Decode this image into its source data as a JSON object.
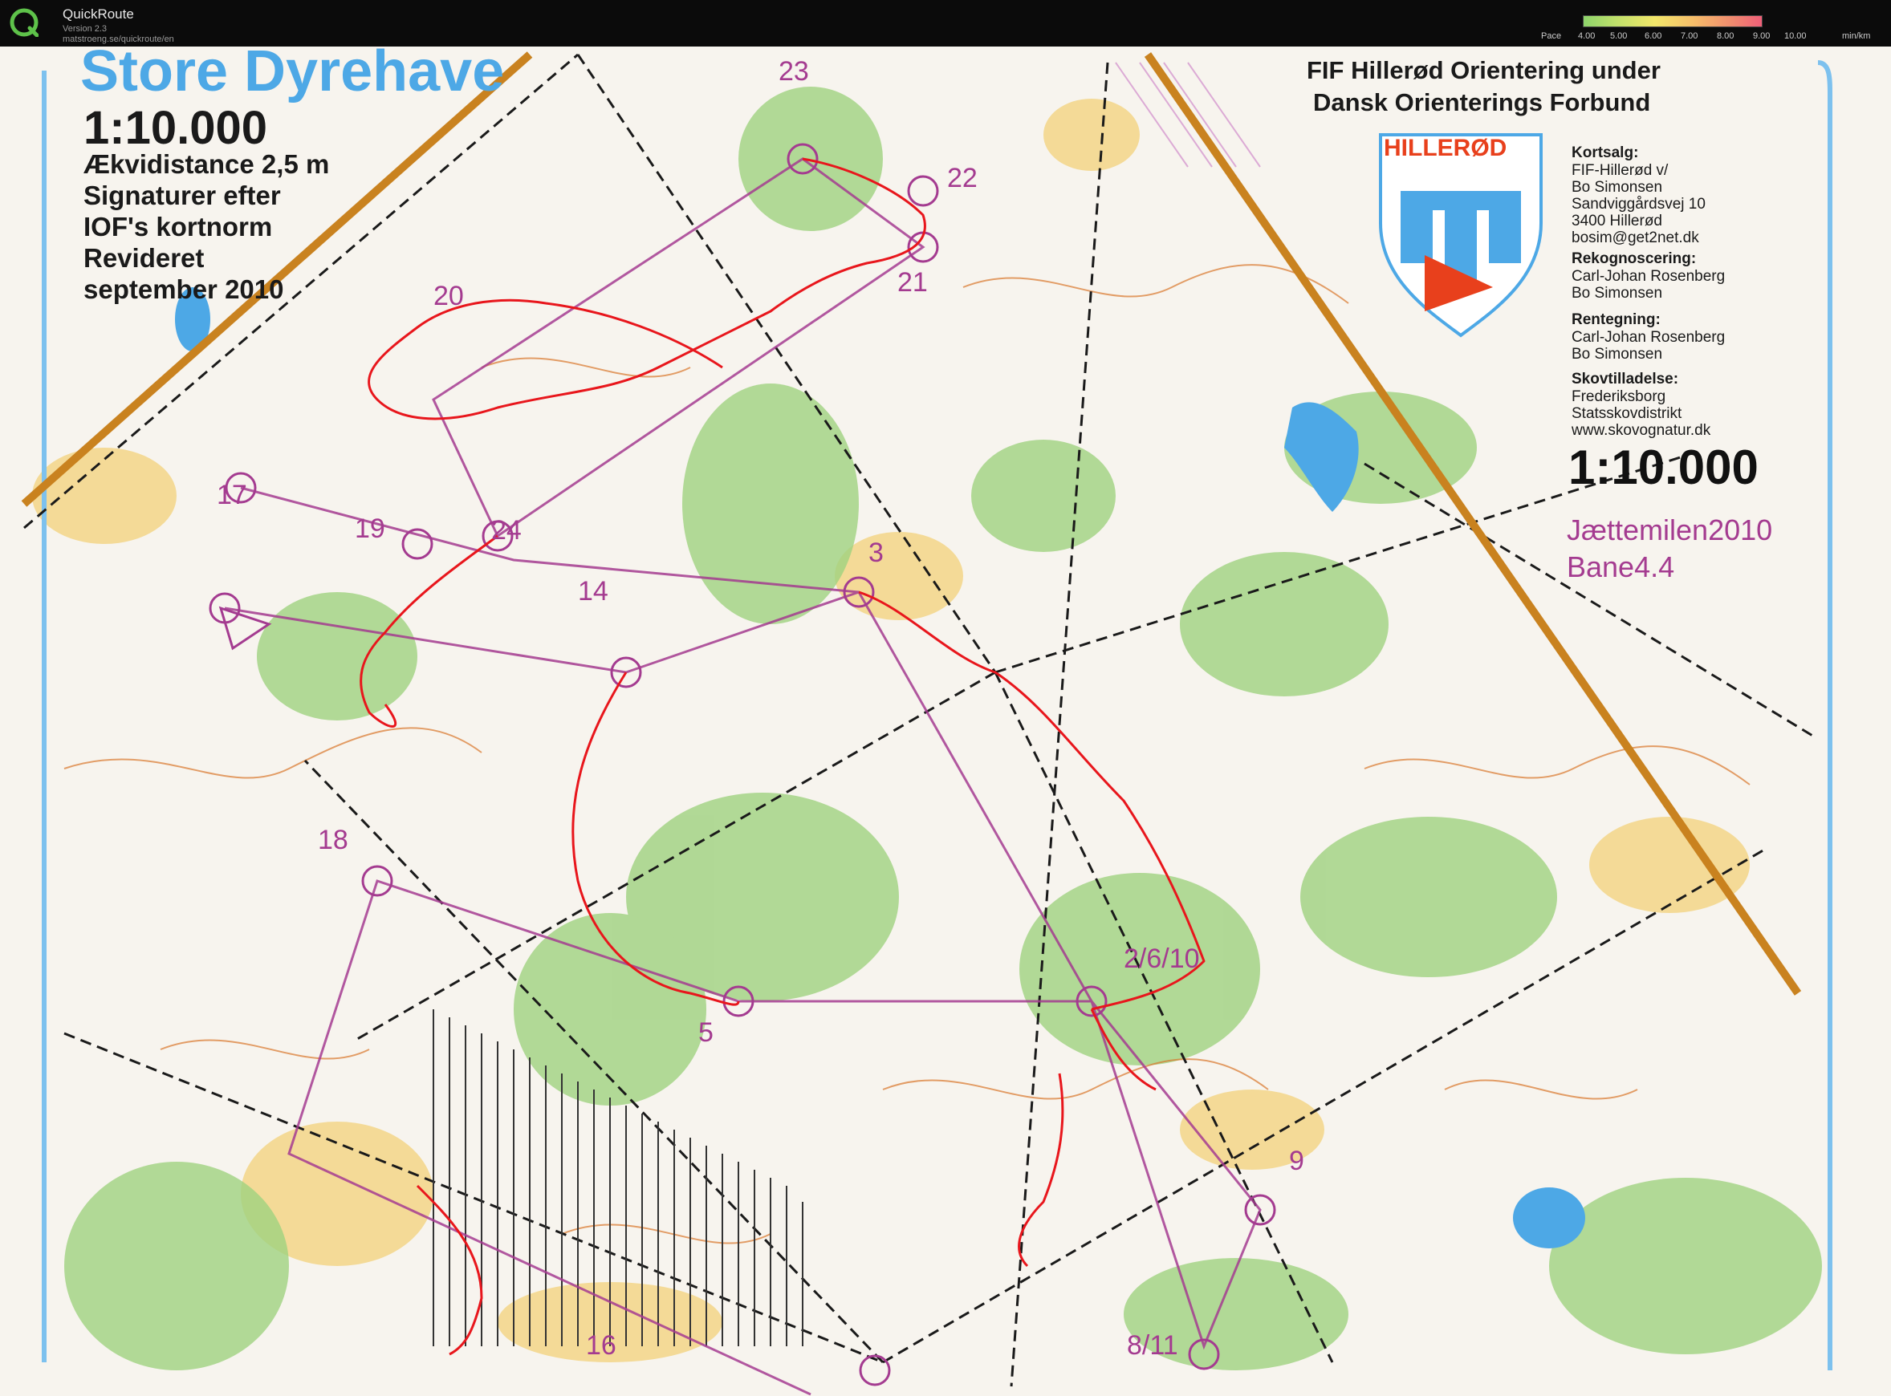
{
  "app": {
    "title": "QuickRoute",
    "version": "Version 2.3",
    "url": "matstroeng.se/quickroute/en"
  },
  "pace_legend": {
    "label": "Pace",
    "ticks": [
      "4.00",
      "5.00",
      "6.00",
      "7.00",
      "8.00",
      "9.00",
      "10.00"
    ],
    "unit": "min/km",
    "colors": [
      "#8ed46b",
      "#f2e76a",
      "#ef5f78"
    ]
  },
  "map": {
    "name": "Store Dyrehave",
    "scale": "1:10.000",
    "legend_lines": [
      "Ækvidistance 2,5 m",
      "Signaturer efter",
      "IOF's kortnorm",
      "Revideret",
      "september 2010"
    ],
    "org_line1": "FIF Hillerød Orientering under",
    "org_line2": "Dansk Orienterings Forbund",
    "club_logo_text": "HILLERØD",
    "kortsalg_heading": "Kortsalg:",
    "kortsalg_lines": [
      "FIF-Hillerød v/",
      "Bo Simonsen",
      "Sandviggårdsvej 10",
      "3400 Hillerød",
      "bosim@get2net.dk"
    ],
    "rekognoscering_heading": "Rekognoscering:",
    "rekognoscering_lines": [
      "Carl-Johan Rosenberg",
      "Bo Simonsen"
    ],
    "rentegning_heading": "Rentegning:",
    "rentegning_lines": [
      "Carl-Johan Rosenberg",
      "Bo Simonsen"
    ],
    "skovtilladelse_heading": "Skovtilladelse:",
    "skovtilladelse_lines": [
      "Frederiksborg",
      "Statsskovdistrikt",
      "www.skovognatur.dk"
    ],
    "scale_right": "1:10.000",
    "event_name": "Jættemilen2010",
    "course_name": "Bane4.4",
    "control_labels": [
      "20",
      "21",
      "22",
      "23",
      "24",
      "19",
      "17",
      "14",
      "3",
      "18",
      "5",
      "2/6/10",
      "9",
      "16",
      "8/11"
    ],
    "colors": {
      "route": "#e8161c",
      "course": "#a43b90",
      "water": "#4da8e6",
      "forest": "#9fd27f",
      "open": "#f3d27a",
      "contour": "#d9762b"
    }
  }
}
